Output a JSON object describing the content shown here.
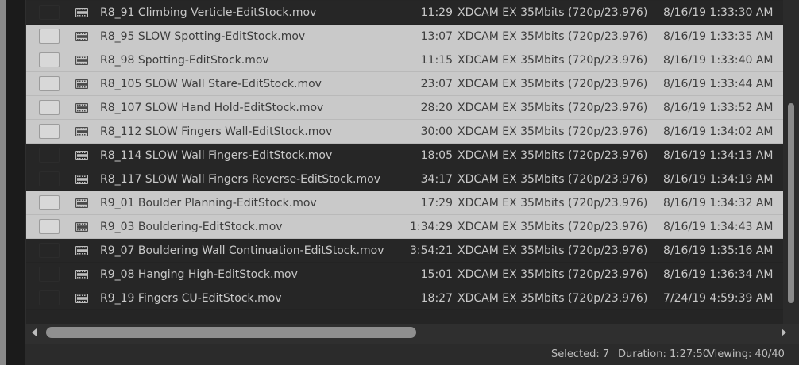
{
  "rows": [
    {
      "name": "R8_91 Climbing Verticle-EditStock.mov",
      "duration": "11:29",
      "format": "XDCAM EX 35Mbits (720p/23.976)",
      "date": "8/16/19 1:33:30 AM",
      "selected": false
    },
    {
      "name": "R8_95 SLOW Spotting-EditStock.mov",
      "duration": "13:07",
      "format": "XDCAM EX 35Mbits (720p/23.976)",
      "date": "8/16/19 1:33:35 AM",
      "selected": true
    },
    {
      "name": "R8_98 Spotting-EditStock.mov",
      "duration": "11:15",
      "format": "XDCAM EX 35Mbits (720p/23.976)",
      "date": "8/16/19 1:33:40 AM",
      "selected": true
    },
    {
      "name": "R8_105 SLOW Wall Stare-EditStock.mov",
      "duration": "23:07",
      "format": "XDCAM EX 35Mbits (720p/23.976)",
      "date": "8/16/19 1:33:44 AM",
      "selected": true
    },
    {
      "name": "R8_107 SLOW Hand Hold-EditStock.mov",
      "duration": "28:20",
      "format": "XDCAM EX 35Mbits (720p/23.976)",
      "date": "8/16/19 1:33:52 AM",
      "selected": true
    },
    {
      "name": "R8_112 SLOW Fingers Wall-EditStock.mov",
      "duration": "30:00",
      "format": "XDCAM EX 35Mbits (720p/23.976)",
      "date": "8/16/19 1:34:02 AM",
      "selected": true
    },
    {
      "name": "R8_114 SLOW Wall Fingers-EditStock.mov",
      "duration": "18:05",
      "format": "XDCAM EX 35Mbits (720p/23.976)",
      "date": "8/16/19 1:34:13 AM",
      "selected": false
    },
    {
      "name": "R8_117 SLOW Wall Fingers Reverse-EditStock.mov",
      "duration": "34:17",
      "format": "XDCAM EX 35Mbits (720p/23.976)",
      "date": "8/16/19 1:34:19 AM",
      "selected": false
    },
    {
      "name": "R9_01 Boulder Planning-EditStock.mov",
      "duration": "17:29",
      "format": "XDCAM EX 35Mbits (720p/23.976)",
      "date": "8/16/19 1:34:32 AM",
      "selected": true
    },
    {
      "name": "R9_03 Bouldering-EditStock.mov",
      "duration": "1:34:29",
      "format": "XDCAM EX 35Mbits (720p/23.976)",
      "date": "8/16/19 1:34:43 AM",
      "selected": true
    },
    {
      "name": "R9_07 Bouldering Wall Continuation-EditStock.mov",
      "duration": "3:54:21",
      "format": "XDCAM EX 35Mbits (720p/23.976)",
      "date": "8/16/19 1:35:16 AM",
      "selected": false
    },
    {
      "name": "R9_08 Hanging High-EditStock.mov",
      "duration": "15:01",
      "format": "XDCAM EX 35Mbits (720p/23.976)",
      "date": "8/16/19 1:36:34 AM",
      "selected": false
    },
    {
      "name": "R9_19 Fingers CU-EditStock.mov",
      "duration": "18:27",
      "format": "XDCAM EX 35Mbits (720p/23.976)",
      "date": "7/24/19 4:59:39 AM",
      "selected": false
    }
  ],
  "status": {
    "selected_text": "Selected: 7",
    "duration_text": "Duration: 1:27:50",
    "viewing_text": "Viewing: 40/40"
  },
  "icons": {
    "row_icon": "film-clip-icon",
    "scroll_left": "scroll-left-arrow-icon",
    "scroll_right": "scroll-right-arrow-icon"
  },
  "colors": {
    "selected_row": "#c9c9c9",
    "unselected_row": "#262626",
    "background": "#1e1e1e"
  }
}
